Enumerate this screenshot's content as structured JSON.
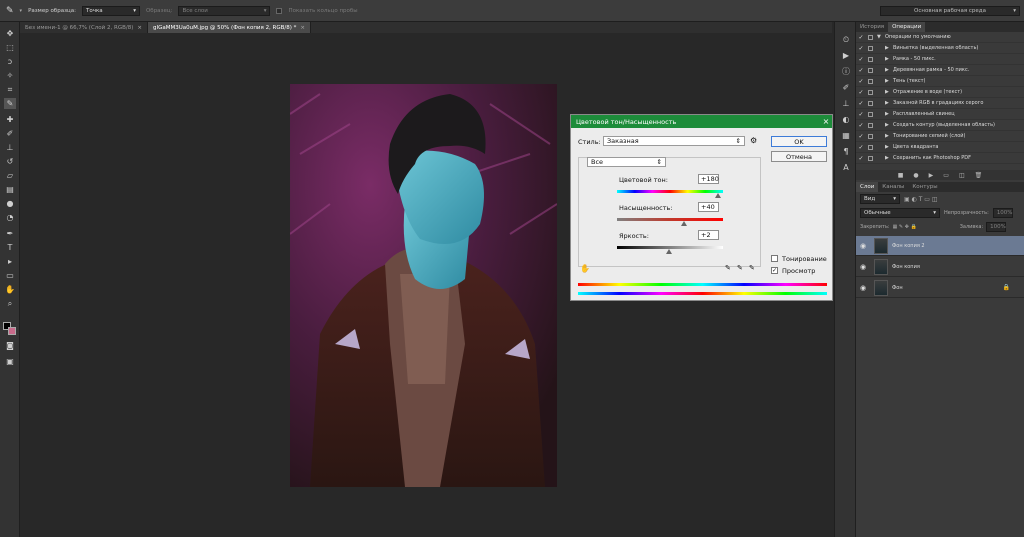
{
  "options_bar": {
    "sample_size_label": "Размер образца:",
    "sample_size_value": "Точка",
    "sample_label": "Образец:",
    "sample_value": "Все слои",
    "show_ring_label": "Показать кольцо пробы",
    "workspace": "Основная рабочая среда"
  },
  "doc_tabs": [
    {
      "label": "Без имени-1 @ 66,7% (Слой 2, RGB/8)",
      "close": "×"
    },
    {
      "label": "gIGaMM3Ua0uM.jpg @ 50% (Фон копия 2, RGB/8) *",
      "close": "×"
    }
  ],
  "dialog": {
    "title": "Цветовой тон/Насыщенность",
    "close": "×",
    "style_label": "Стиль:",
    "style_value": "Заказная",
    "ok_label": "OK",
    "cancel_label": "Отмена",
    "channel_value": "Все",
    "hue_label": "Цветовой тон:",
    "hue_value": "+180",
    "hue_level": 0.95,
    "saturation_label": "Насыщенность:",
    "saturation_value": "+40",
    "saturation_level": 0.63,
    "lightness_label": "Яркость:",
    "lightness_value": "+2",
    "lightness_level": 0.49,
    "colorize_label": "Тонирование",
    "preview_label": "Просмотр",
    "preview_checked": "✓"
  },
  "history_panel": {
    "tabs": [
      "История",
      "Операции"
    ],
    "actions": [
      "Операции по умолчанию",
      "Виньетка (выделенная область)",
      "Рамка - 50 пикс.",
      "Деревянная рамка - 50 пикс.",
      "Тень (текст)",
      "Отражение в воде (текст)",
      "Заказной RGB в градациях серого",
      "Расплавленный свинец",
      "Создать контур (выделенная область)",
      "Тонирование сепией (слой)",
      "Цвета квадранта",
      "Сохранить как Photoshop PDF"
    ]
  },
  "layers_panel": {
    "tabs": [
      "Слои",
      "Каналы",
      "Контуры"
    ],
    "kind_label": "Вид",
    "blend_mode": "Обычные",
    "opacity_label": "Непрозрачность:",
    "opacity_value": "100%",
    "lock_label": "Закрепить:",
    "fill_label": "Заливка:",
    "fill_value": "100%",
    "layers": [
      {
        "name": "Фон копия 2",
        "active": true
      },
      {
        "name": "Фон копия",
        "active": false
      },
      {
        "name": "Фон",
        "active": false
      }
    ]
  },
  "colors": {
    "dialog_title_bar": "#1d8c3a",
    "active_layer": "#6b7a93"
  }
}
